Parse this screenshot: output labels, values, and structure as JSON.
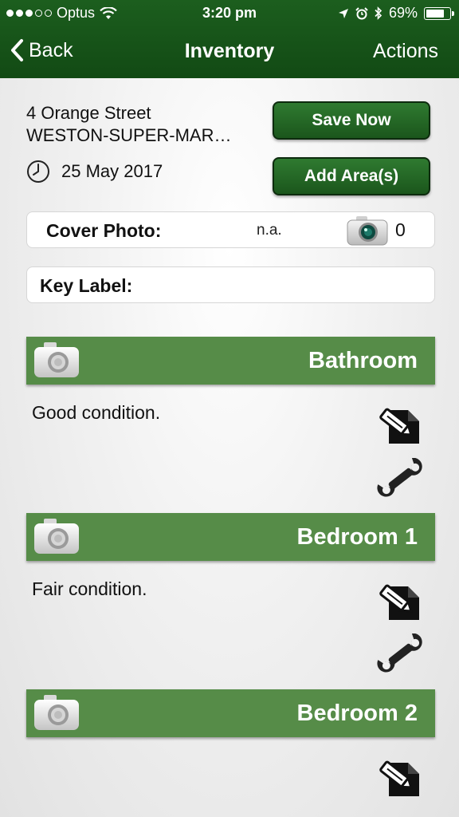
{
  "status_bar": {
    "carrier": "Optus",
    "signal_bars_filled": 3,
    "signal_bars_total": 5,
    "time": "3:20 pm",
    "battery_percent": "69%"
  },
  "nav": {
    "back_label": "Back",
    "title": "Inventory",
    "actions_label": "Actions"
  },
  "property": {
    "street": "4 Orange Street",
    "town": "WESTON-SUPER-MAR…",
    "date": "25 May 2017"
  },
  "buttons": {
    "save": "Save Now",
    "add_area": "Add Area(s)"
  },
  "cover_photo": {
    "label": "Cover Photo:",
    "value": "n.a.",
    "count": "0"
  },
  "key_label": {
    "label": "Key Label:",
    "value": ""
  },
  "areas": [
    {
      "name": "Bathroom",
      "description": "Good condition."
    },
    {
      "name": "Bedroom 1",
      "description": "Fair condition."
    },
    {
      "name": "Bedroom 2",
      "description": ""
    }
  ],
  "colors": {
    "nav_green": "#1c5e1e",
    "area_bar_green": "#568c48",
    "button_green": "#2f7a30"
  }
}
